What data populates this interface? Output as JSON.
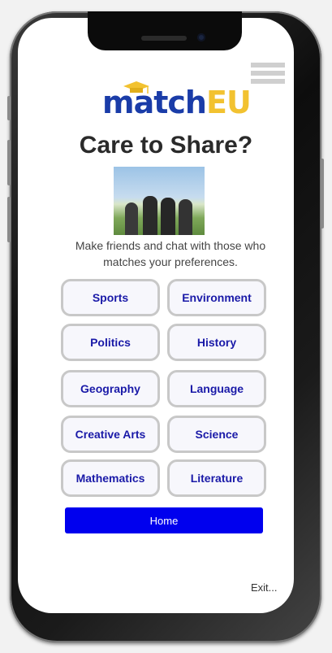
{
  "app": {
    "logo_part1": "match",
    "logo_part2": "EU",
    "title": "Care to Share?",
    "description": "Make friends and chat with those who matches your preferences."
  },
  "menu": {
    "icon": "hamburger-menu-icon"
  },
  "topics": [
    {
      "label": "Sports"
    },
    {
      "label": "Environment"
    },
    {
      "label": "Politics"
    },
    {
      "label": "History"
    },
    {
      "label": "Geography"
    },
    {
      "label": "Language"
    },
    {
      "label": "Creative Arts"
    },
    {
      "label": "Science"
    },
    {
      "label": "Mathematics"
    },
    {
      "label": "Literature"
    }
  ],
  "actions": {
    "home_label": "Home",
    "exit_label": "Exit..."
  },
  "colors": {
    "brand_blue": "#1a3ca8",
    "brand_yellow": "#f2c230",
    "topic_text": "#1a1aa8",
    "home_button": "#0000ee"
  }
}
